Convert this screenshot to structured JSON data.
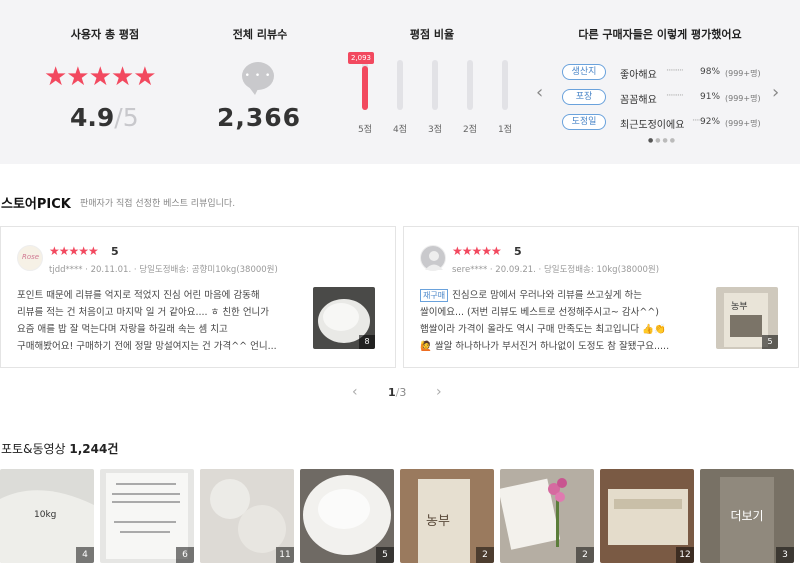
{
  "summary": {
    "total_rating": {
      "title": "사용자 총 평점",
      "stars": "★★★★★",
      "score": "4.9",
      "out_of": "/5"
    },
    "total_reviews": {
      "title": "전체 리뷰수",
      "bubble_dots": "• • •",
      "count": "2,366"
    },
    "rating_ratio": {
      "title": "평점 비율",
      "top_count_label": "2,093",
      "bars": [
        {
          "label": "5점",
          "share": 0.88
        },
        {
          "label": "4점",
          "share": 0
        },
        {
          "label": "3점",
          "share": 0
        },
        {
          "label": "2점",
          "share": 0
        },
        {
          "label": "1점",
          "share": 0
        }
      ]
    },
    "buyer_opinions": {
      "title": "다른 구매자들은 이렇게 평가했어요",
      "prev_arrow": "‹",
      "next_arrow": "›",
      "traits": [
        {
          "tag": "생산지",
          "phrase": "좋아해요",
          "leader": "·········",
          "percent": "98%",
          "count": "(999+명)"
        },
        {
          "tag": "포장",
          "phrase": "꼼꼼해요",
          "leader": "·········",
          "percent": "91%",
          "count": "(999+명)"
        },
        {
          "tag": "도정일",
          "phrase": "최근도정이에요",
          "leader": "·····",
          "percent": "92%",
          "count": "(999+명)"
        }
      ],
      "pager_dots": "● ● ● ●"
    }
  },
  "store_pick": {
    "title": "스토어PICK",
    "description": "판매자가 직접 선정한 베스트 리뷰입니다.",
    "reviews": [
      {
        "avatar_text": "Rose",
        "stars": "★★★★★",
        "score": "5",
        "meta": "tjdd**** · 20.11.01. · 당일도정배송: 공향미10kg(38000원)",
        "badge": "",
        "lines": [
          "포인트 때문에 리뷰를 억지로 적었지 진심 어린 마음에 감동해",
          "리뷰를 적는 건 처음이고 마지막 일 거 같아요.... ㅎ 친한 언니가",
          "요즘 애를 밥 잘 먹는다며 자랑을 하길래 속는 셈 치고",
          "구매해봤어요! 구매하기 전에 정말 망설여지는 건 가격^^ 언니..."
        ],
        "photo_count": "8"
      },
      {
        "avatar_text": "",
        "stars": "★★★★★",
        "score": "5",
        "meta": "sere**** · 20.09.21. · 당일도정배송: 10kg(38000원)",
        "badge": "재구매",
        "lines": [
          "진심으로 맘에서 우러나와 리뷰를 쓰고싶게 하는",
          "쌀이에요... (저번 리뷰도 베스트로 선정해주시고~ 감사^^)",
          "햅쌀이라 가격이 올라도 역시 구매 만족도는 최고입니다 👍👏",
          "🙋 쌀알 하나하나가 부서진거 하나없이 도정도 참 잘됐구요....."
        ],
        "photo_count": "5"
      }
    ],
    "pager": {
      "prev": "‹",
      "current": "1",
      "separator": "/",
      "total": "3",
      "next": "›"
    }
  },
  "photo_section": {
    "title": "포토&동영상",
    "count": "1,244건",
    "photos": [
      {
        "count": "4"
      },
      {
        "count": "6"
      },
      {
        "count": "11"
      },
      {
        "count": "5"
      },
      {
        "count": "2"
      },
      {
        "count": "2"
      },
      {
        "count": "12"
      },
      {
        "count": "3"
      }
    ],
    "more_label": "더보기"
  },
  "colors": {
    "accent_red": "#f2495f",
    "tag_blue": "#4a86c8",
    "summary_bg": "#f4f4f6"
  }
}
